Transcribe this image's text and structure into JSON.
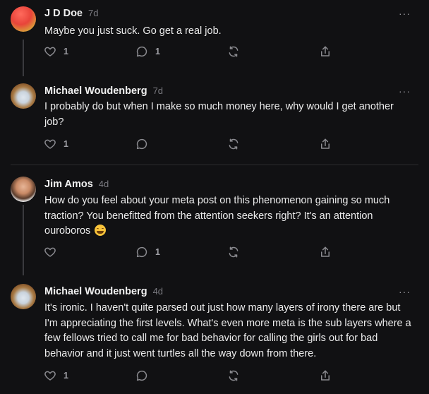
{
  "comments": [
    {
      "author": "J D Doe",
      "time": "7d",
      "more": "···",
      "text": "Maybe you just suck. Go get a real job.",
      "likes": "1",
      "replies": "1"
    },
    {
      "author": "Michael Woudenberg",
      "time": "7d",
      "more": "···",
      "text": "I probably do but when I make so much money here, why would I get another job?",
      "likes": "1",
      "replies": ""
    },
    {
      "author": "Jim Amos",
      "time": "4d",
      "more": "···",
      "text": "How do you feel about your meta post on this phenomenon gaining so much traction? You benefitted from the attention seekers right? It's an attention ouroboros",
      "likes": "",
      "replies": "1"
    },
    {
      "author": "Michael Woudenberg",
      "time": "4d",
      "more": "···",
      "text": "It's ironic. I haven't quite parsed out just how many layers of irony there are but I'm appreciating the first levels. What's even more meta is the sub layers where a few fellows tried to call me for bad behavior for calling the girls out for bad behavior and it just went turtles all the way down from there.",
      "likes": "1",
      "replies": ""
    }
  ],
  "icons": {
    "like": "heart-icon",
    "reply": "speech-bubble-icon",
    "restack": "restack-icon",
    "share": "share-icon",
    "more": "ellipsis-icon",
    "emoji": "grinning-sweat-emoji"
  },
  "colors": {
    "background": "#111113",
    "text": "#ececec",
    "muted": "#8b8b90",
    "divider": "#2b2b2e"
  }
}
